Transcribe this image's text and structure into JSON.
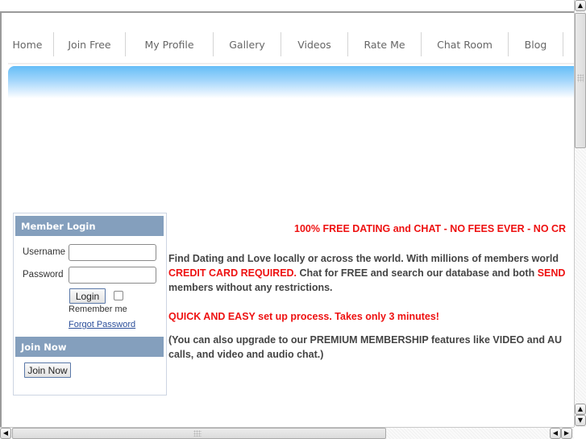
{
  "nav": {
    "items": [
      {
        "label": "Home"
      },
      {
        "label": "Join Free"
      },
      {
        "label": "My Profile"
      },
      {
        "label": "Gallery"
      },
      {
        "label": "Videos"
      },
      {
        "label": "Rate Me"
      },
      {
        "label": "Chat Room"
      },
      {
        "label": "Blog"
      }
    ]
  },
  "sidebar": {
    "login_heading": "Member Login",
    "username_label": "Username",
    "username_value": "",
    "password_label": "Password",
    "password_value": "",
    "login_button": "Login",
    "remember_label": "Remember me",
    "remember_checked": false,
    "forgot_link": "Forgot Password",
    "join_heading": "Join Now",
    "join_button": "Join Now"
  },
  "main": {
    "headline": "100% FREE DATING and CHAT - NO FEES EVER - NO CR",
    "para1_line1": "Find Dating and Love locally or across the world. With millions of members world",
    "para1_line2_red": "CREDIT CARD REQUIRED.",
    "para1_line2_rest": " Chat for FREE and search our database and both ",
    "para1_line2_red_tail": "SEND",
    "para1_line3": "members without any restrictions.",
    "quick": "QUICK AND EASY set up process. Takes only 3 minutes!",
    "premium_line1": "(You can also upgrade to our PREMIUM MEMBERSHIP features like VIDEO and AU",
    "premium_line2": "calls, and video and audio chat.)"
  },
  "colors": {
    "accent_red": "#ee1111",
    "sidebar_header": "#849fbd",
    "link": "#2b4e9a",
    "banner_top": "#66bdf7"
  },
  "scrollbars": {
    "vertical_up_icon": "arrow-up",
    "vertical_down_icon": "arrow-down",
    "horizontal_left_icon": "arrow-left",
    "horizontal_right_icon": "arrow-right"
  }
}
